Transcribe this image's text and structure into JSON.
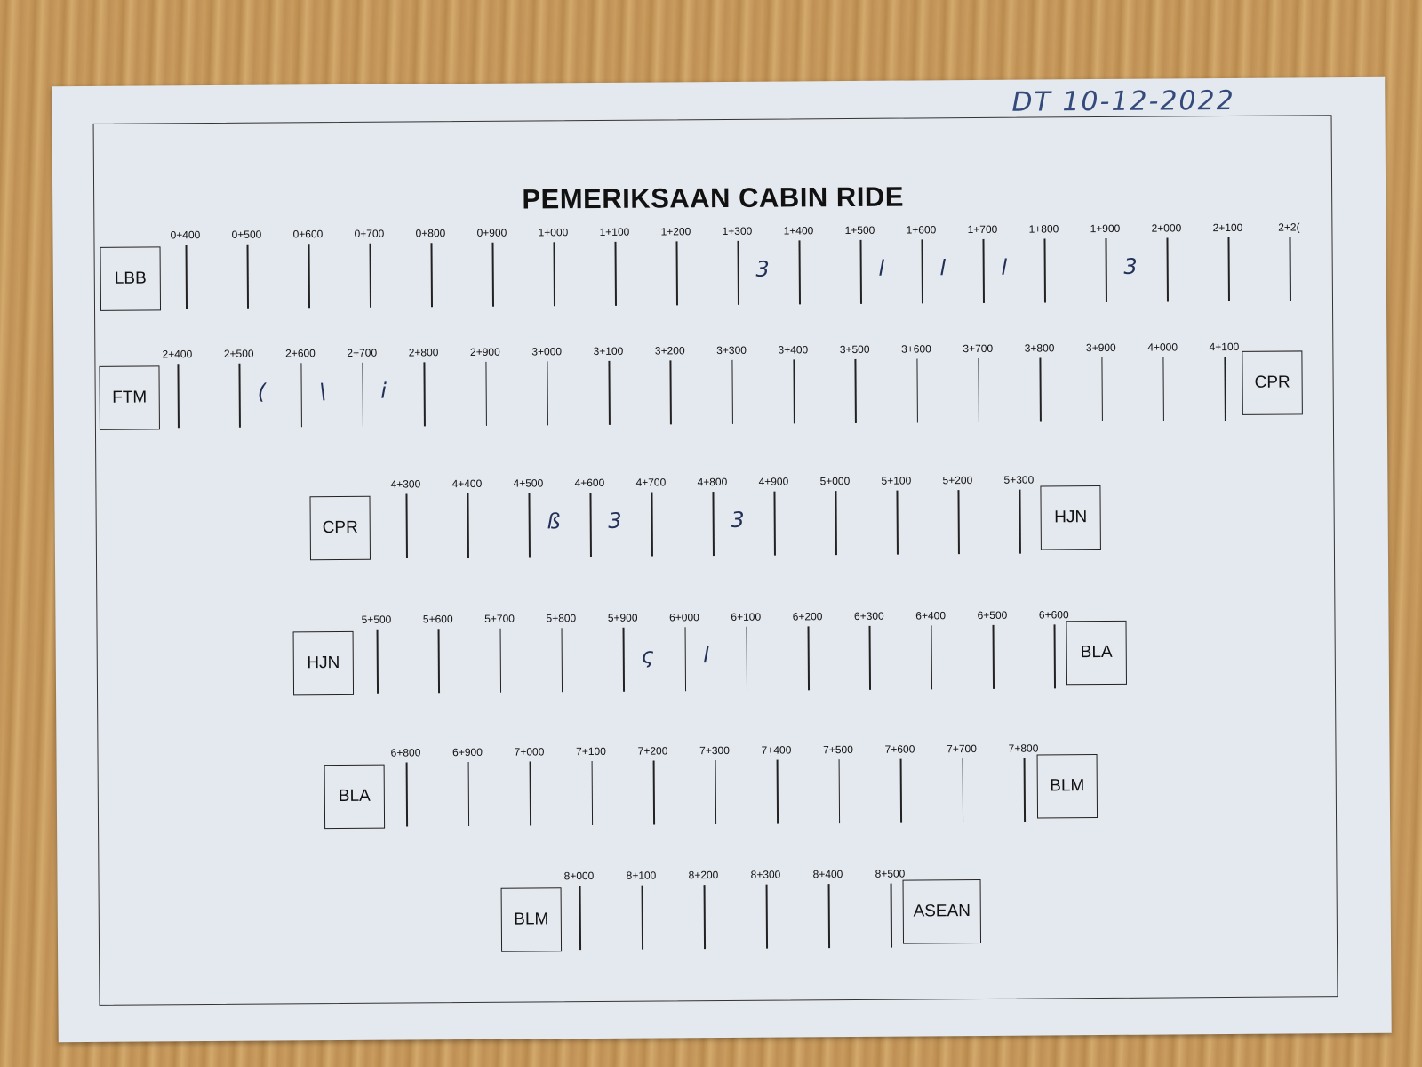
{
  "header": {
    "title": "PEMERIKSAAN CABIN RIDE",
    "handwritten_date": "DT    10-12-2022"
  },
  "rows": [
    {
      "start": "LBB",
      "end": "",
      "markers": [
        "0+400",
        "0+500",
        "0+600",
        "0+700",
        "0+800",
        "0+900",
        "1+000",
        "1+100",
        "1+200",
        "1+300",
        "1+400",
        "1+500",
        "1+600",
        "1+700",
        "1+800",
        "1+900",
        "2+000",
        "2+100",
        "2+2("
      ],
      "notes": [
        {
          "after": 9,
          "text": "3"
        },
        {
          "after": 11,
          "text": "l"
        },
        {
          "after": 12,
          "text": "l"
        },
        {
          "after": 13,
          "text": "l"
        },
        {
          "after": 15,
          "text": "3"
        }
      ]
    },
    {
      "start": "FTM",
      "end": "CPR",
      "markers": [
        "2+400",
        "2+500",
        "2+600",
        "2+700",
        "2+800",
        "2+900",
        "3+000",
        "3+100",
        "3+200",
        "3+300",
        "3+400",
        "3+500",
        "3+600",
        "3+700",
        "3+800",
        "3+900",
        "4+000",
        "4+100"
      ],
      "notes": [
        {
          "after": 1,
          "text": "("
        },
        {
          "after": 2,
          "text": "\\"
        },
        {
          "after": 3,
          "text": "i"
        }
      ]
    },
    {
      "start": "CPR",
      "end": "HJN",
      "markers": [
        "4+300",
        "4+400",
        "4+500",
        "4+600",
        "4+700",
        "4+800",
        "4+900",
        "5+000",
        "5+100",
        "5+200",
        "5+300"
      ],
      "notes": [
        {
          "after": 2,
          "text": "ß"
        },
        {
          "after": 3,
          "text": "3"
        },
        {
          "after": 5,
          "text": "3"
        }
      ]
    },
    {
      "start": "HJN",
      "end": "BLA",
      "markers": [
        "5+500",
        "5+600",
        "5+700",
        "5+800",
        "5+900",
        "6+000",
        "6+100",
        "6+200",
        "6+300",
        "6+400",
        "6+500",
        "6+600"
      ],
      "notes": [
        {
          "after": 4,
          "text": "ς"
        },
        {
          "after": 5,
          "text": "l"
        }
      ]
    },
    {
      "start": "BLA",
      "end": "BLM",
      "markers": [
        "6+800",
        "6+900",
        "7+000",
        "7+100",
        "7+200",
        "7+300",
        "7+400",
        "7+500",
        "7+600",
        "7+700",
        "7+800"
      ],
      "notes": []
    },
    {
      "start": "BLM",
      "end": "ASEAN",
      "markers": [
        "8+000",
        "8+100",
        "8+200",
        "8+300",
        "8+400",
        "8+500"
      ],
      "notes": []
    }
  ]
}
